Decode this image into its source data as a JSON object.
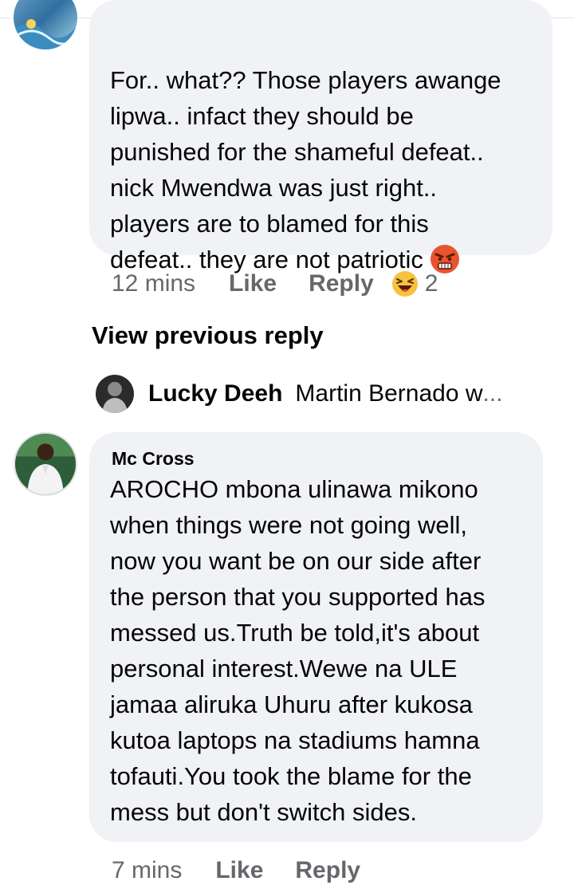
{
  "comment1": {
    "text": "For.. what?? Those players awange\nlipwa.. infact they should be\npunished for the shameful defeat..\nnick Mwendwa was just right..\nplayers are to blamed for this\ndefeat.. they are not patriotic",
    "emoji_icon": "angry-face-icon",
    "time": "12 mins",
    "like_label": "Like",
    "reply_label": "Reply",
    "reaction_icon": "haha-reaction-icon",
    "reaction_count": "2"
  },
  "view_previous": "View previous reply",
  "reply_preview": {
    "name": "Lucky Deeh",
    "text": "Martin Bernado w",
    "ellipsis": "..."
  },
  "comment2": {
    "author": "Mc Cross",
    "text": "AROCHO mbona ulinawa mikono\nwhen things were not going well,\nnow you want be on our side after\nthe person that you supported has\nmessed us.Truth be told,it's about\npersonal interest.Wewe na ULE\njamaa aliruka Uhuru after kukosa\nkutoa laptops na stadiums hamna\ntofauti.You took the blame for the\nmess but don't switch sides.",
    "time": "7 mins",
    "like_label": "Like",
    "reply_label": "Reply"
  },
  "colors": {
    "bubble": "#f0f2f5",
    "meta_text": "#65676b",
    "primary_text": "#050505"
  }
}
